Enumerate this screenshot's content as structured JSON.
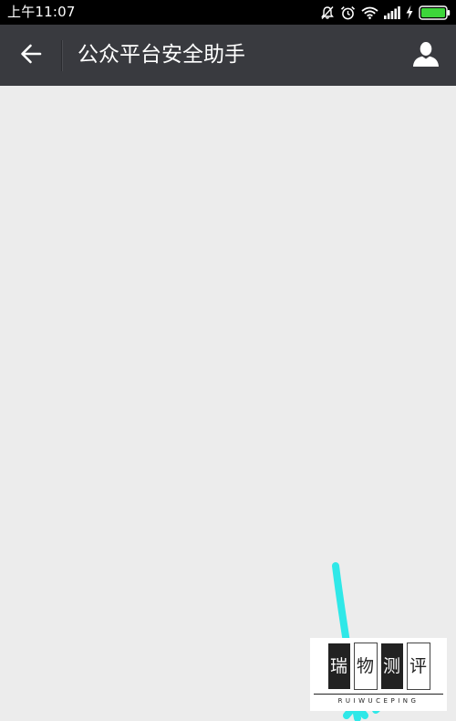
{
  "status_bar": {
    "time": "上午11:07",
    "icons": [
      "mute-icon",
      "alarm-icon",
      "wifi-icon",
      "signal-icon",
      "charging-icon",
      "battery-icon"
    ],
    "battery_color": "#3dd63a"
  },
  "header": {
    "back_icon": "arrow-left-icon",
    "title": "公众平台安全助手",
    "profile_icon": "person-icon",
    "background": "#393a3f"
  },
  "content": {
    "background": "#ececec"
  },
  "watermark": {
    "chars": [
      "瑞",
      "物",
      "测",
      "评"
    ],
    "subtitle": "RUIWUCEPING"
  },
  "annotation": {
    "color": "#2fe8e8"
  }
}
